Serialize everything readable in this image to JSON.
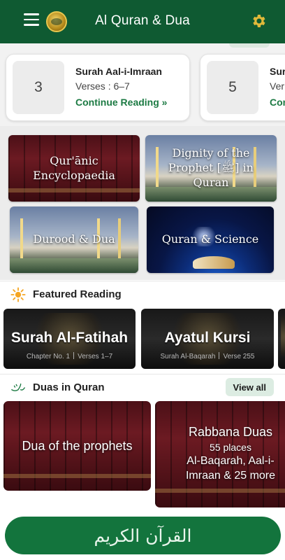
{
  "header": {
    "title": "Al Quran & Dua",
    "menu_icon": "hamburger-menu-icon",
    "logo_icon": "quran-logo-icon",
    "settings_icon": "gear-icon",
    "bg_color": "#0f5a32"
  },
  "continue_cards": [
    {
      "number": "3",
      "surah": "Surah Aal-i-Imraan",
      "verses": "Verses : 6–7",
      "link": "Continue Reading »"
    },
    {
      "number": "5",
      "surah": "Sur",
      "verses": "Ver",
      "link": "Con"
    }
  ],
  "categories": [
    {
      "label": "Qur'ānic Encyclopaedia"
    },
    {
      "label": "Dignity of the Prophet [ﷺ] in Quran"
    },
    {
      "label": "Durood & Dua"
    },
    {
      "label": "Quran & Science"
    }
  ],
  "featured": {
    "title": "Featured Reading",
    "icon": "star-burst-icon",
    "items": [
      {
        "title": "Surah Al-Fatihah",
        "sub1": "Chapter No. 1",
        "sub2": "Verses 1–7"
      },
      {
        "title": "Ayatul Kursi",
        "sub1": "Surah Al-Baqarah",
        "sub2": "Verse 255"
      }
    ]
  },
  "duas": {
    "title": "Duas in Quran",
    "icon": "rabbana-calligraphy-icon",
    "view_all": "View all",
    "items": [
      {
        "title": "Dua of the prophets"
      },
      {
        "title": "Rabbana Duas",
        "count": "55 places",
        "desc": "Al-Baqarah, Aal-i-Imraan & 25 more"
      }
    ]
  },
  "bottom_button": {
    "label": "القرآن الكريم",
    "color": "#13743d"
  },
  "colors": {
    "accent_green": "#1c7a43",
    "view_all_bg": "#dcece2"
  }
}
